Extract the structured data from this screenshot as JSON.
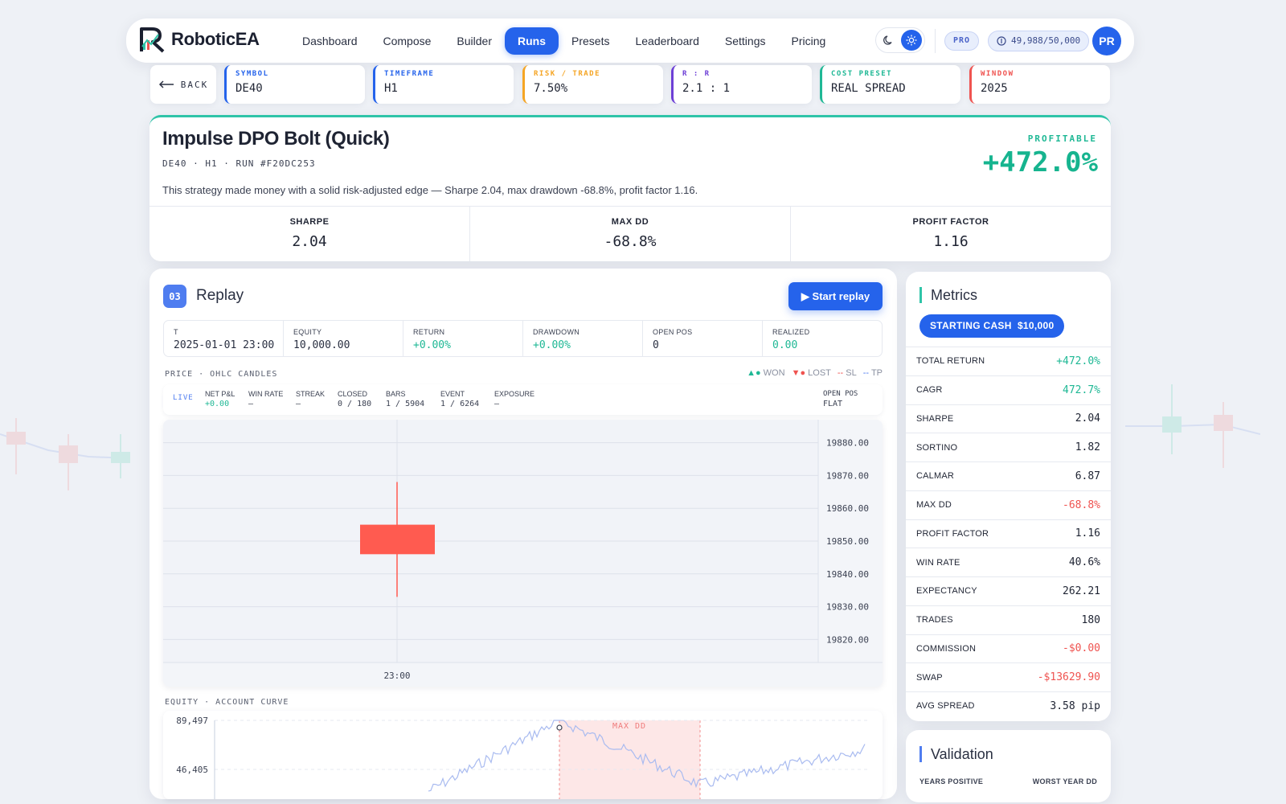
{
  "brand": {
    "name": "RoboticEA"
  },
  "nav": {
    "items": [
      "Dashboard",
      "Compose",
      "Builder",
      "Runs",
      "Presets",
      "Leaderboard",
      "Settings",
      "Pricing"
    ],
    "active": "Runs",
    "plan": "PRO",
    "credits": "49,988/50,000",
    "avatar": "PR"
  },
  "params": {
    "back": "BACK",
    "items": [
      {
        "label": "SYMBOL",
        "value": "DE40",
        "color": "#2563eb"
      },
      {
        "label": "TIMEFRAME",
        "value": "H1",
        "color": "#2563eb"
      },
      {
        "label": "RISK / TRADE",
        "value": "7.50%",
        "color": "#f5a524"
      },
      {
        "label": "R : R",
        "value": "2.1 : 1",
        "color": "#6d3fd6"
      },
      {
        "label": "COST PRESET",
        "value": "REAL SPREAD",
        "color": "#1fb895"
      },
      {
        "label": "WINDOW",
        "value": "2025",
        "color": "#ef5350"
      }
    ]
  },
  "summary": {
    "title": "Impulse DPO Bolt (Quick)",
    "subtitle": "DE40 · H1 · RUN #F20DC253",
    "description": "This strategy made money with a solid risk-adjusted edge — Sharpe 2.04, max drawdown -68.8%, profit factor 1.16.",
    "status": "PROFITABLE",
    "return": "+472.0%",
    "kpis": [
      {
        "label": "SHARPE",
        "value": "2.04"
      },
      {
        "label": "MAX DD",
        "value": "-68.8%"
      },
      {
        "label": "PROFIT FACTOR",
        "value": "1.16"
      }
    ]
  },
  "replay": {
    "step": "03",
    "title": "Replay",
    "start_label": "▶ Start replay",
    "stats": [
      {
        "label": "T",
        "value": "2025-01-01 23:00",
        "tone": ""
      },
      {
        "label": "EQUITY",
        "value": "10,000.00",
        "tone": ""
      },
      {
        "label": "RETURN",
        "value": "+0.00%",
        "tone": "g"
      },
      {
        "label": "DRAWDOWN",
        "value": "+0.00%",
        "tone": "g"
      },
      {
        "label": "OPEN POS",
        "value": "0",
        "tone": ""
      },
      {
        "label": "REALIZED",
        "value": "0.00",
        "tone": "g"
      }
    ],
    "price_label": "PRICE · OHLC CANDLES",
    "legend": {
      "won": "WON",
      "lost": "LOST",
      "sl": "SL",
      "tp": "TP"
    },
    "ticker": {
      "live": "LIVE",
      "items": [
        {
          "label": "NET P&L",
          "value": "+0.00",
          "tone": "g"
        },
        {
          "label": "WIN RATE",
          "value": "—",
          "tone": ""
        },
        {
          "label": "STREAK",
          "value": "—",
          "tone": ""
        },
        {
          "label": "CLOSED",
          "value": "0 / 180",
          "tone": ""
        },
        {
          "label": "BARS",
          "value": "1 / 5904",
          "tone": ""
        },
        {
          "label": "EVENT",
          "value": "1 / 6264",
          "tone": ""
        },
        {
          "label": "EXPOSURE",
          "value": "—",
          "tone": ""
        }
      ],
      "open_pos_label": "OPEN POS",
      "open_pos_value": "FLAT"
    },
    "equity_label": "EQUITY · ACCOUNT CURVE",
    "equity_maxdd": "MAX DD"
  },
  "chart_data": [
    {
      "type": "candlestick",
      "y_ticks": [
        "19880.00",
        "19870.00",
        "19860.00",
        "19850.00",
        "19840.00",
        "19830.00",
        "19820.00"
      ],
      "ylim": [
        19813,
        19887
      ],
      "x_ticks": [
        "23:00"
      ],
      "candles": [
        {
          "t": "23:00",
          "open": 19855,
          "high": 19868,
          "low": 19833,
          "close": 19846,
          "direction": "down"
        }
      ]
    },
    {
      "type": "line",
      "y_ticks": [
        "89,497",
        "46,405"
      ],
      "ylim": [
        3313,
        89497
      ],
      "shaded_region": {
        "label": "MAX DD"
      }
    }
  ],
  "metrics": {
    "title": "Metrics",
    "starting_cash": "STARTING CASH  $10,000",
    "rows": [
      {
        "label": "TOTAL RETURN",
        "value": "+472.0%",
        "tone": "green"
      },
      {
        "label": "CAGR",
        "value": "472.7%",
        "tone": "green"
      },
      {
        "label": "SHARPE",
        "value": "2.04",
        "tone": ""
      },
      {
        "label": "SORTINO",
        "value": "1.82",
        "tone": ""
      },
      {
        "label": "CALMAR",
        "value": "6.87",
        "tone": ""
      },
      {
        "label": "MAX DD",
        "value": "-68.8%",
        "tone": "red"
      },
      {
        "label": "PROFIT FACTOR",
        "value": "1.16",
        "tone": ""
      },
      {
        "label": "WIN RATE",
        "value": "40.6%",
        "tone": ""
      },
      {
        "label": "EXPECTANCY",
        "value": "262.21",
        "tone": ""
      },
      {
        "label": "TRADES",
        "value": "180",
        "tone": ""
      },
      {
        "label": "COMMISSION",
        "value": "-$0.00",
        "tone": "red"
      },
      {
        "label": "SWAP",
        "value": "-$13629.90",
        "tone": "red"
      },
      {
        "label": "AVG SPREAD",
        "value": "3.58 pip",
        "tone": ""
      }
    ]
  },
  "validation": {
    "title": "Validation",
    "years_positive": "YEARS POSITIVE",
    "worst_year_dd": "WORST YEAR DD"
  },
  "colors": {
    "accent": "#2563eb",
    "profit": "#1fb895",
    "loss": "#ef5350"
  }
}
